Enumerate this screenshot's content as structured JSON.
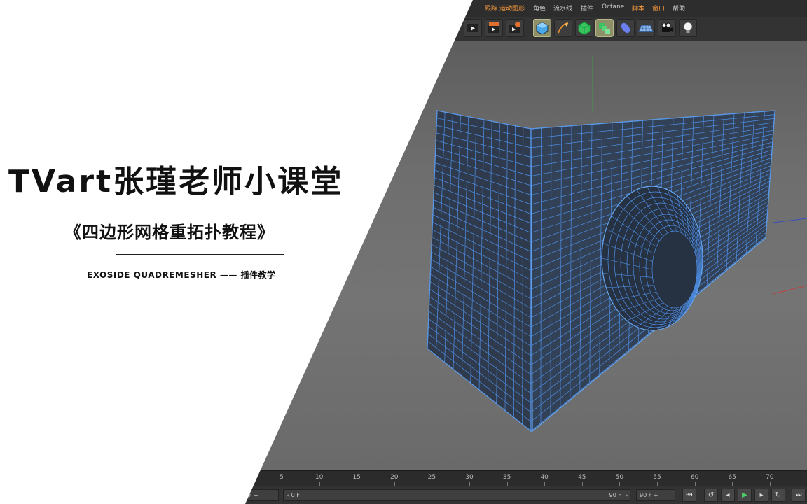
{
  "menu": {
    "items": [
      "跟踪",
      "运动图形",
      "角色",
      "流水线",
      "插件",
      "Octane",
      "脚本",
      "窗口",
      "帮助"
    ]
  },
  "toolbar": {
    "tools": [
      "render-view-icon",
      "render-to-picture-viewer-icon",
      "render-settings-icon",
      "cube-icon",
      "pen-spline-icon",
      "subdivision-surface-icon",
      "cloner-icon",
      "deformer-icon",
      "floor-icon",
      "camera-icon",
      "light-icon"
    ]
  },
  "title_panel": {
    "title": "TVart张瑾老师小课堂",
    "subtitle": "《四边形网格重拓扑教程》",
    "tagline": "EXOSIDE QUADREMESHER —— 插件教学"
  },
  "timeline": {
    "ticks": [
      "5",
      "10",
      "15",
      "20",
      "25",
      "30",
      "35",
      "40",
      "45",
      "50",
      "55",
      "60",
      "65",
      "70"
    ]
  },
  "transport": {
    "current_frame": "0 F",
    "end_frame": "90 F",
    "max_frame": "90 F",
    "left_field": "F"
  },
  "colors": {
    "mesh_wire": "#4f8fe6",
    "mesh_fill": "#2f3b4d",
    "accent_menu": "#ff9d3b"
  }
}
